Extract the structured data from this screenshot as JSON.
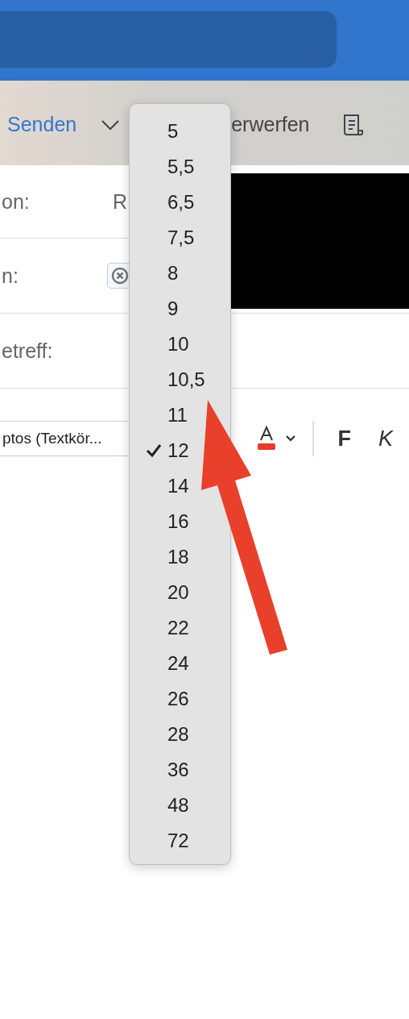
{
  "toolbar": {
    "send": "Senden",
    "discard": "erwerfen"
  },
  "form": {
    "from_label": "on:",
    "from_value": "R",
    "to_label": "n:",
    "subject_label": "etreff:"
  },
  "format_bar": {
    "font": "ptos (Textkör...",
    "bold": "F",
    "italic": "K"
  },
  "size_menu": [
    {
      "label": "5",
      "selected": false
    },
    {
      "label": "5,5",
      "selected": false
    },
    {
      "label": "6,5",
      "selected": false
    },
    {
      "label": "7,5",
      "selected": false
    },
    {
      "label": "8",
      "selected": false
    },
    {
      "label": "9",
      "selected": false
    },
    {
      "label": "10",
      "selected": false
    },
    {
      "label": "10,5",
      "selected": false
    },
    {
      "label": "11",
      "selected": false
    },
    {
      "label": "12",
      "selected": true
    },
    {
      "label": "14",
      "selected": false
    },
    {
      "label": "16",
      "selected": false
    },
    {
      "label": "18",
      "selected": false
    },
    {
      "label": "20",
      "selected": false
    },
    {
      "label": "22",
      "selected": false
    },
    {
      "label": "24",
      "selected": false
    },
    {
      "label": "26",
      "selected": false
    },
    {
      "label": "28",
      "selected": false
    },
    {
      "label": "36",
      "selected": false
    },
    {
      "label": "48",
      "selected": false
    },
    {
      "label": "72",
      "selected": false
    }
  ]
}
